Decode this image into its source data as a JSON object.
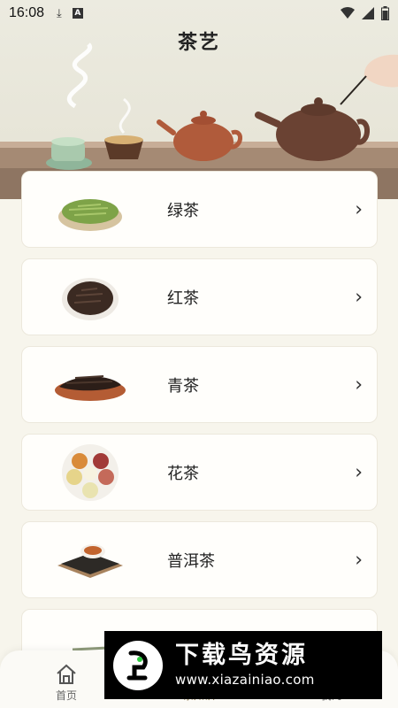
{
  "status_bar": {
    "time": "16:08",
    "left_icons": [
      "download-icon",
      "a-icon"
    ],
    "right_icons": [
      "wifi-icon",
      "signal-icon",
      "battery-icon"
    ]
  },
  "header": {
    "title": "茶艺"
  },
  "tea_list": [
    {
      "name": "绿茶",
      "icon": "green-tea-thumb"
    },
    {
      "name": "红茶",
      "icon": "black-tea-thumb"
    },
    {
      "name": "青茶",
      "icon": "oolong-tea-thumb"
    },
    {
      "name": "花茶",
      "icon": "flower-tea-thumb"
    },
    {
      "name": "普洱茶",
      "icon": "puer-tea-thumb"
    }
  ],
  "bottom_nav": [
    {
      "label": "首页",
      "icon": "home-icon"
    },
    {
      "label": "茶知识",
      "icon": "tea-knowledge-icon"
    },
    {
      "label": "我的",
      "icon": "profile-icon"
    }
  ],
  "watermark": {
    "title": "下载鸟资源",
    "url": "www.xiazainiao.com"
  },
  "colors": {
    "background": "#f7f5ec",
    "card": "#fffefb",
    "accent": "#8d7a52",
    "table": "#a58a74"
  }
}
